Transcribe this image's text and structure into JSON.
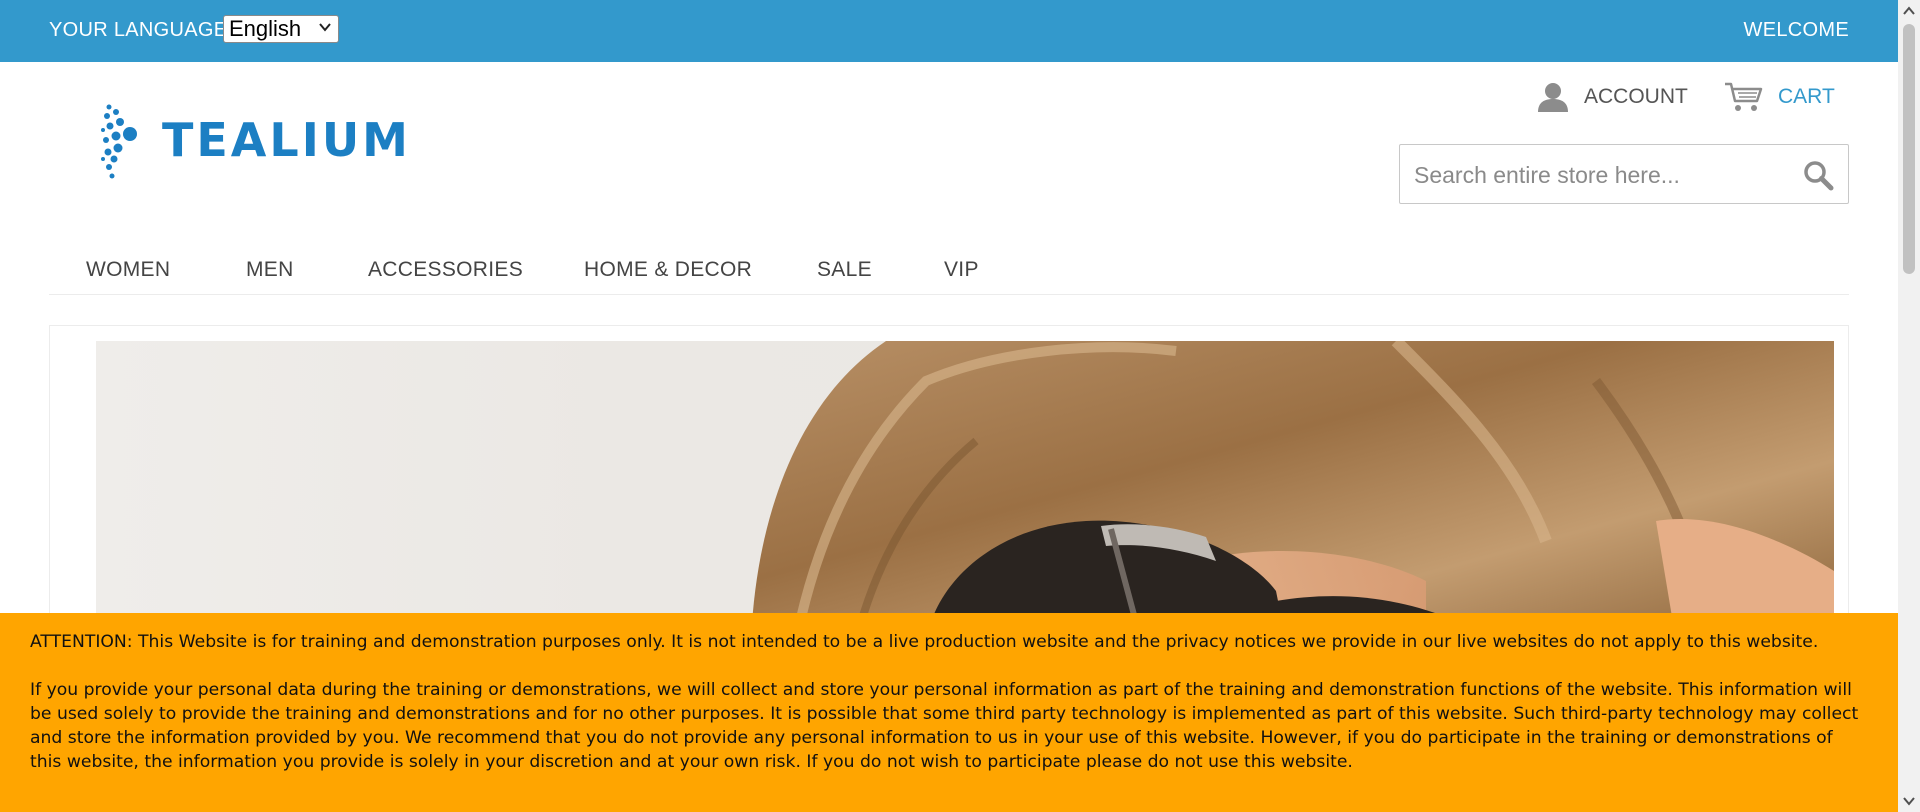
{
  "topbar": {
    "language_label": "YOUR LANGUAGE:",
    "language_selected": "English",
    "welcome": "WELCOME"
  },
  "header": {
    "logo_text": "TEALIUM",
    "account_label": "ACCOUNT",
    "cart_label": "CART",
    "search_placeholder": "Search entire store here..."
  },
  "nav": {
    "items": [
      "WOMEN",
      "MEN",
      "ACCESSORIES",
      "HOME & DECOR",
      "SALE",
      "VIP"
    ]
  },
  "notice": {
    "paragraph1": "ATTENTION: This Website is for training and demonstration purposes only. It is not intended to be a live production website and the privacy notices we provide in our live websites do not apply to this website.",
    "paragraph2": "If you provide your personal data during the training or demonstrations, we will collect and store your personal information as part of the training and demonstration functions of the website. This information will be used solely to provide the training and demonstrations and for no other purposes. It is possible that some third party technology is implemented as part of this website. Such third-party technology may collect and store the information provided by you. We recommend that you do not provide any personal information to us in your use of this website. However, if you do participate in the training or demonstrations of this website, the information you provide is solely in your discretion and at your own risk. If you do not wish to participate please do not use this website."
  },
  "colors": {
    "topbar": "#3399cc",
    "brand": "#1c7fc3",
    "notice": "#ffa500"
  },
  "icons": {
    "chevron": "chevron-down-icon",
    "account": "user-icon",
    "cart": "cart-icon",
    "search": "search-icon"
  }
}
